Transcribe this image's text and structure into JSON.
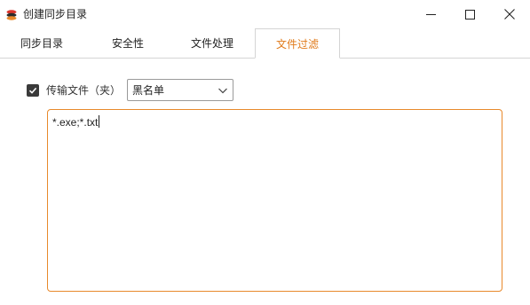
{
  "window": {
    "title": "创建同步目录",
    "icon": "app-logo-icon"
  },
  "tabs": [
    {
      "label": "同步目录",
      "active": false
    },
    {
      "label": "安全性",
      "active": false
    },
    {
      "label": "文件处理",
      "active": false
    },
    {
      "label": "文件过滤",
      "active": true
    }
  ],
  "filter": {
    "checkbox_label": "传输文件（夹）",
    "checked": true,
    "mode_selected": "黑名单",
    "pattern_text": "*.exe;*.txt"
  },
  "colors": {
    "accent": "#e07a1a",
    "textarea_border": "#e8892b"
  }
}
